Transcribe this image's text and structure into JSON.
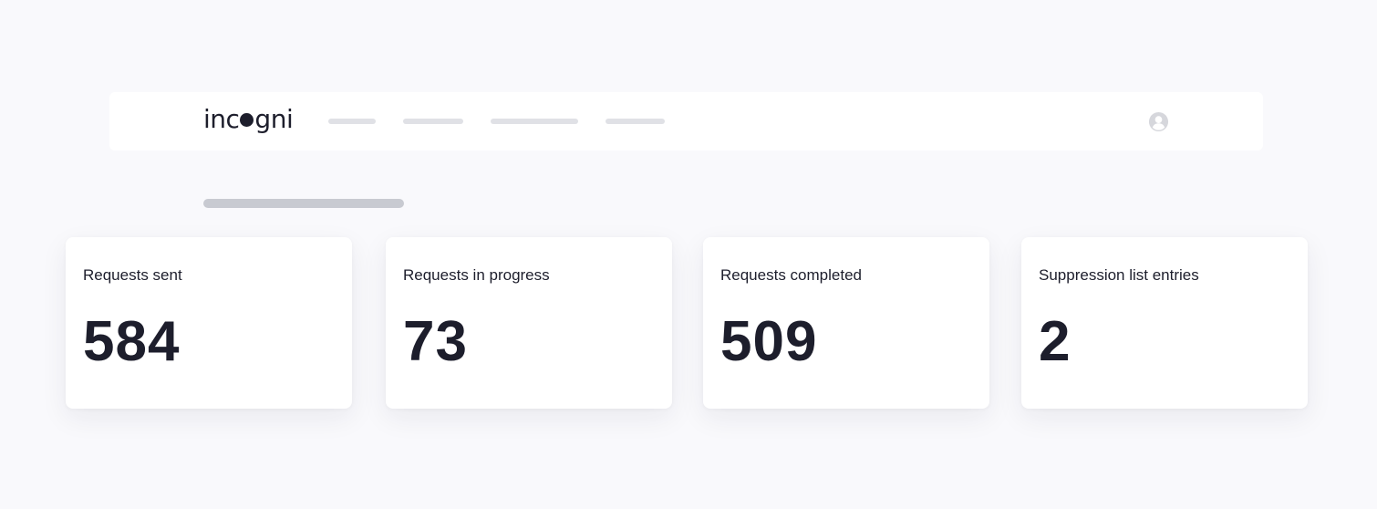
{
  "header": {
    "logo_left": "inc",
    "logo_right": "gni",
    "avatar_icon": "user-circle-icon"
  },
  "stats": [
    {
      "label": "Requests sent",
      "value": "584"
    },
    {
      "label": "Requests in progress",
      "value": "73"
    },
    {
      "label": "Requests completed",
      "value": "509"
    },
    {
      "label": "Suppression list entries",
      "value": "2"
    }
  ],
  "colors": {
    "background": "#f9f9fc",
    "card": "#ffffff",
    "text": "#1d1e2c",
    "placeholder": "#e0e1e6",
    "placeholder_dark": "#c8cad1",
    "avatar": "#d6d7dc"
  }
}
